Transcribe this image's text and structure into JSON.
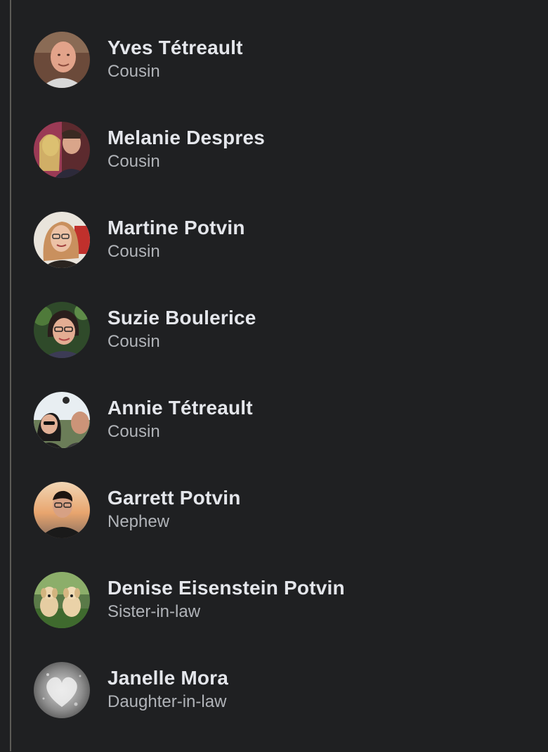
{
  "relatives": [
    {
      "name": "Yves Tétreault",
      "relation": "Cousin",
      "avatar_icon": "person-photo-icon"
    },
    {
      "name": "Melanie Despres",
      "relation": "Cousin",
      "avatar_icon": "couple-photo-icon"
    },
    {
      "name": "Martine Potvin",
      "relation": "Cousin",
      "avatar_icon": "person-photo-icon"
    },
    {
      "name": "Suzie Boulerice",
      "relation": "Cousin",
      "avatar_icon": "person-photo-icon"
    },
    {
      "name": "Annie Tétreault",
      "relation": "Cousin",
      "avatar_icon": "couple-photo-icon"
    },
    {
      "name": "Garrett Potvin",
      "relation": "Nephew",
      "avatar_icon": "person-photo-icon"
    },
    {
      "name": "Denise Eisenstein Potvin",
      "relation": "Sister-in-law",
      "avatar_icon": "dogs-photo-icon"
    },
    {
      "name": "Janelle Mora",
      "relation": "Daughter-in-law",
      "avatar_icon": "heart-photo-icon"
    }
  ],
  "colors": {
    "background": "#1f2022",
    "name_text": "#e4e6eb",
    "secondary_text": "#b0b3b8",
    "divider": "#5c5b57"
  }
}
